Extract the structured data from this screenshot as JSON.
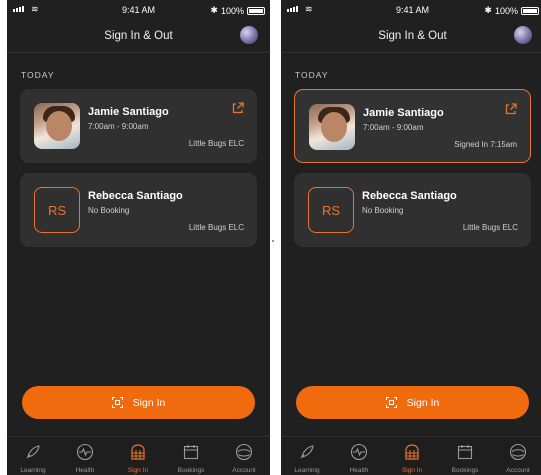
{
  "status_bar": {
    "time": "9:41 AM",
    "battery": "100%"
  },
  "header": {
    "title": "Sign In & Out"
  },
  "section": {
    "label": "TODAY"
  },
  "left_screen": {
    "cards": [
      {
        "name": "Jamie Santiago",
        "subtitle": "7:00am - 9:00am",
        "location": "Little Bugs ELC",
        "status": ""
      },
      {
        "name": "Rebecca Santiago",
        "initials": "RS",
        "subtitle": "No Booking",
        "location": "Little Bugs ELC"
      }
    ]
  },
  "right_screen": {
    "cards": [
      {
        "name": "Jamie Santiago",
        "subtitle": "7:00am - 9:00am",
        "status": "Signed In 7:15am"
      },
      {
        "name": "Rebecca Santiago",
        "initials": "RS",
        "subtitle": "No Booking",
        "location": "Little Bugs ELC"
      }
    ]
  },
  "sign_in_button": {
    "label": "Sign In"
  },
  "tabs": [
    {
      "label": "Learning",
      "icon": "rocket-icon"
    },
    {
      "label": "Health",
      "icon": "heart-monitor-icon"
    },
    {
      "label": "Sign In",
      "icon": "sign-in-icon",
      "active": true
    },
    {
      "label": "Bookings",
      "icon": "calendar-icon"
    },
    {
      "label": "Account",
      "icon": "account-icon"
    }
  ],
  "colors": {
    "accent": "#f06a0e",
    "background": "#202020",
    "card": "#303030"
  }
}
